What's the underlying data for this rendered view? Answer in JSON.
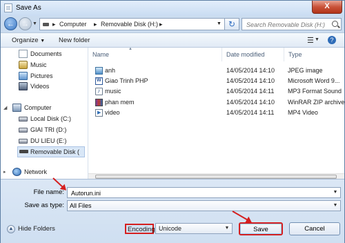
{
  "window": {
    "title": "Save As",
    "close_label": "X"
  },
  "nav": {
    "breadcrumb": [
      "Computer",
      "Removable Disk (H:)"
    ],
    "search_placeholder": "Search Removable Disk (H:)"
  },
  "toolbar": {
    "organize": "Organize",
    "new_folder": "New folder"
  },
  "sidebar": {
    "libraries": [
      {
        "label": "Documents",
        "icon": "documents-icon"
      },
      {
        "label": "Music",
        "icon": "music-icon"
      },
      {
        "label": "Pictures",
        "icon": "pictures-icon"
      },
      {
        "label": "Videos",
        "icon": "videos-icon"
      }
    ],
    "computer_label": "Computer",
    "drives": [
      {
        "label": "Local Disk (C:)"
      },
      {
        "label": "GIAI TRI (D:)"
      },
      {
        "label": "DU LIEU (E:)"
      },
      {
        "label": "Removable Disk ("
      }
    ],
    "network_label": "Network"
  },
  "file_list": {
    "columns": [
      "Name",
      "Date modified",
      "Type"
    ],
    "rows": [
      {
        "name": "anh",
        "date": "14/05/2014 14:10",
        "type": "JPEG image",
        "icon": "jpeg-file-icon"
      },
      {
        "name": "Giao Trinh PHP",
        "date": "14/05/2014 14:10",
        "type": "Microsoft Word 9...",
        "icon": "word-file-icon"
      },
      {
        "name": "music",
        "date": "14/05/2014 14:11",
        "type": "MP3 Format Sound",
        "icon": "mp3-file-icon"
      },
      {
        "name": "phan mem",
        "date": "14/05/2014 14:10",
        "type": "WinRAR ZIP archive",
        "icon": "winrar-file-icon"
      },
      {
        "name": "video",
        "date": "14/05/2014 14:11",
        "type": "MP4 Video",
        "icon": "mp4-file-icon"
      }
    ]
  },
  "form": {
    "file_name_label": "File name:",
    "file_name_value": "Autorun.ini",
    "save_as_type_label": "Save as type:",
    "save_as_type_value": "All Files",
    "encoding_label": "Encoding:",
    "encoding_value": "Unicode"
  },
  "buttons": {
    "hide_folders": "Hide Folders",
    "save": "Save",
    "cancel": "Cancel"
  },
  "colors": {
    "highlight": "#d51f1f",
    "window_frame": "#cbdcef"
  }
}
